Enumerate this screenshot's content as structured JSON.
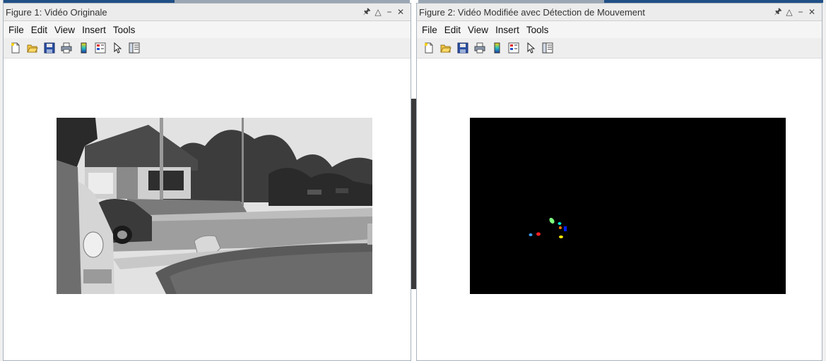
{
  "figure1": {
    "title": "Figure 1: Vidéo Originale",
    "menu": [
      "File",
      "Edit",
      "View",
      "Insert",
      "Tools"
    ],
    "toolbar_icons": [
      "new-figure-icon",
      "open-file-icon",
      "save-icon",
      "print-icon",
      "colorbar-icon",
      "legend-icon",
      "pointer-icon",
      "property-editor-icon"
    ]
  },
  "figure2": {
    "title": "Figure 2: Vidéo Modifiée avec Détection de Mouvement",
    "menu": [
      "File",
      "Edit",
      "View",
      "Insert",
      "Tools"
    ],
    "toolbar_icons": [
      "new-figure-icon",
      "open-file-icon",
      "save-icon",
      "print-icon",
      "colorbar-icon",
      "legend-icon",
      "pointer-icon",
      "property-editor-icon"
    ],
    "blob_colors": [
      "#3aa0ff",
      "#ff2020",
      "#7dff7d",
      "#00e5d0",
      "#ff7a00",
      "#0020ff",
      "#ffe800"
    ]
  },
  "window_controls": {
    "pin": "🖈",
    "restore": "△",
    "minimize": "−",
    "close": "✕"
  }
}
